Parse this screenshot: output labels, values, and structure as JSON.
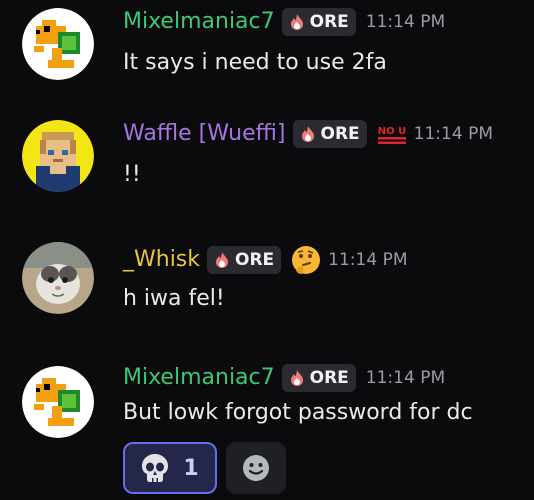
{
  "messages": [
    {
      "username": "Mixelmaniac7",
      "name_color": "#3ec775",
      "tag": "ORE",
      "time": "11:14 PM",
      "text": "It says i need to use 2fa",
      "avatar": "turtle-avatar"
    },
    {
      "username": "Waffle [Wueffi]",
      "name_color": "#a477e0",
      "tag": "ORE",
      "badge": "NO U",
      "time": "11:14 PM",
      "text": "!!",
      "avatar": "blocky-character-avatar"
    },
    {
      "username": "_Whisk",
      "name_color": "#e8c63a",
      "tag": "ORE",
      "emoji": "thinking-face-icon",
      "time": "11:14 PM",
      "text": "h iwa fel!",
      "avatar": "cat-avatar"
    },
    {
      "username": "Mixelmaniac7",
      "name_color": "#3ec775",
      "tag": "ORE",
      "time": "11:14 PM",
      "text": "But lowk forgot password for dc",
      "avatar": "turtle-avatar"
    }
  ],
  "reactions": [
    {
      "emoji": "skull-icon",
      "count": "1",
      "selected": true
    }
  ],
  "add_reaction": {
    "icon": "smiley-icon"
  }
}
